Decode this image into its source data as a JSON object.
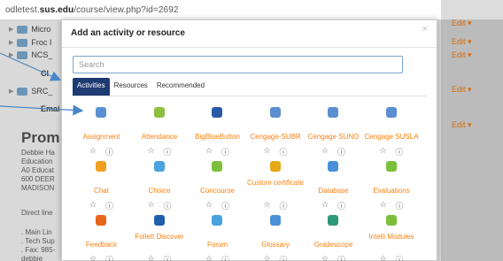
{
  "url": {
    "prefix": "odletest.",
    "domain": "sus.edu",
    "path": "/course/view.php?id=2692"
  },
  "background": {
    "rows": [
      {
        "label": "Micro"
      },
      {
        "label": "Froc I"
      },
      {
        "label": "NCS_"
      },
      {
        "label": "Cl"
      },
      {
        "label": "SRC_"
      },
      {
        "label": "Emai"
      }
    ],
    "heading": "Prom",
    "text_lines": [
      "Debbie Ha",
      "Education",
      "A0 Educat",
      "600 DEER",
      "MADISON"
    ],
    "text_lines_2": [
      "Direct line"
    ],
    "text_lines_3": [
      ". Main Lin",
      ". Tech Sup",
      ". Fax: 985-",
      "debbie"
    ],
    "edit_label": "Edit ▾"
  },
  "dialog": {
    "title": "Add an activity or resource",
    "close": "×",
    "search_placeholder": "Search",
    "tabs": [
      "Activities",
      "Resources",
      "Recommended"
    ],
    "star_glyph": "☆",
    "info_glyph": "ⓘ",
    "activities": [
      {
        "label": "Assignment",
        "icon": "assignment-icon",
        "color": "#5b8fd1"
      },
      {
        "label": "Attendance",
        "icon": "attendance-icon",
        "color": "#8fbf3e"
      },
      {
        "label": "BigBlueButton",
        "icon": "bigbluebutton-icon",
        "color": "#2b5aa6"
      },
      {
        "label": "Cengage-SUBR",
        "icon": "cengage-icon",
        "color": "#5b8fd1"
      },
      {
        "label": "Cengage SUNO",
        "icon": "cengage-icon",
        "color": "#5b8fd1"
      },
      {
        "label": "Cengage SUSLA",
        "icon": "cengage-icon",
        "color": "#5b8fd1"
      },
      {
        "label": "Chat",
        "icon": "chat-icon",
        "color": "#f0a020"
      },
      {
        "label": "Choice",
        "icon": "choice-icon",
        "color": "#4aa3df"
      },
      {
        "label": "Concourse",
        "icon": "puzzle-icon",
        "color": "#7cbf3c"
      },
      {
        "label": "Custom certificate",
        "icon": "certificate-icon",
        "color": "#e6a817"
      },
      {
        "label": "Database",
        "icon": "database-icon",
        "color": "#4a90d9"
      },
      {
        "label": "Evaluations",
        "icon": "puzzle-icon",
        "color": "#7cbf3c"
      },
      {
        "label": "Feedback",
        "icon": "megaphone-icon",
        "color": "#e8671a"
      },
      {
        "label": "Follett Discover",
        "icon": "cart-icon",
        "color": "#1f5fae"
      },
      {
        "label": "Forum",
        "icon": "forum-icon",
        "color": "#4aa3df"
      },
      {
        "label": "Glossary",
        "icon": "glossary-icon",
        "color": "#4a90d9"
      },
      {
        "label": "Gradescope",
        "icon": "gradescope-icon",
        "color": "#2f9a7a"
      },
      {
        "label": "Intelli Modules",
        "icon": "puzzle-icon",
        "color": "#7cbf3c"
      }
    ]
  }
}
